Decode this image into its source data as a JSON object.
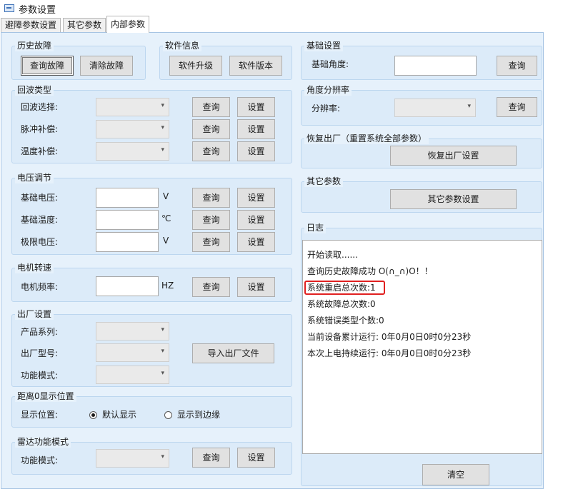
{
  "window": {
    "title": "参数设置"
  },
  "tabs": [
    "避障参数设置",
    "其它参数",
    "内部参数"
  ],
  "history_fault": {
    "title": "历史故障",
    "query": "查询故障",
    "clear": "清除故障"
  },
  "software": {
    "title": "软件信息",
    "upgrade": "软件升级",
    "version": "软件版本"
  },
  "basic": {
    "title": "基础设置",
    "angle_label": "基础角度:",
    "query": "查询"
  },
  "echo": {
    "title": "回波类型",
    "rows": [
      {
        "label": "回波选择:",
        "query": "查询",
        "set": "设置"
      },
      {
        "label": "脉冲补偿:",
        "query": "查询",
        "set": "设置"
      },
      {
        "label": "温度补偿:",
        "query": "查询",
        "set": "设置"
      }
    ]
  },
  "resolution": {
    "title": "角度分辨率",
    "label": "分辨率:",
    "query": "查询"
  },
  "factory_reset": {
    "title": "恢复出厂（重置系统全部参数）",
    "button": "恢复出厂设置"
  },
  "voltage": {
    "title": "电压调节",
    "rows": [
      {
        "label": "基础电压:",
        "unit": "V",
        "query": "查询",
        "set": "设置"
      },
      {
        "label": "基础温度:",
        "unit": "℃",
        "query": "查询",
        "set": "设置"
      },
      {
        "label": "极限电压:",
        "unit": "V",
        "query": "查询",
        "set": "设置"
      }
    ]
  },
  "other": {
    "title": "其它参数",
    "button": "其它参数设置"
  },
  "log": {
    "title": "日志",
    "lines": [
      "开始读取......",
      "查询历史故障成功 O(∩_∩)O！！",
      "系统重启总次数:1",
      "系统故障总次数:0",
      "系统错误类型个数:0",
      "当前设备累计运行:  0年0月0日0时0分23秒",
      "本次上电持续运行:  0年0月0日0时0分23秒"
    ],
    "clear": "清空",
    "highlight_color": "#e02020"
  },
  "motor": {
    "title": "电机转速",
    "label": "电机频率:",
    "unit": "HZ",
    "query": "查询",
    "set": "设置"
  },
  "factory": {
    "title": "出厂设置",
    "series": "产品系列:",
    "model": "出厂型号:",
    "mode": "功能模式:",
    "import": "导入出厂文件"
  },
  "distance": {
    "title": "距离0显示位置",
    "label": "显示位置:",
    "option_default": "默认显示",
    "option_edge": "显示到边缘",
    "selected": "默认显示"
  },
  "radar": {
    "title": "雷达功能模式",
    "label": "功能模式:",
    "query": "查询",
    "set": "设置"
  }
}
